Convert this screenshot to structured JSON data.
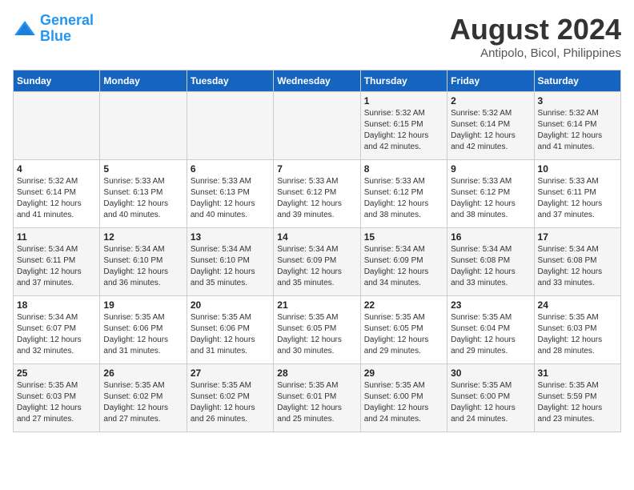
{
  "header": {
    "logo_line1": "General",
    "logo_line2": "Blue",
    "main_title": "August 2024",
    "subtitle": "Antipolo, Bicol, Philippines"
  },
  "weekdays": [
    "Sunday",
    "Monday",
    "Tuesday",
    "Wednesday",
    "Thursday",
    "Friday",
    "Saturday"
  ],
  "weeks": [
    [
      {
        "day": "",
        "info": ""
      },
      {
        "day": "",
        "info": ""
      },
      {
        "day": "",
        "info": ""
      },
      {
        "day": "",
        "info": ""
      },
      {
        "day": "1",
        "info": "Sunrise: 5:32 AM\nSunset: 6:15 PM\nDaylight: 12 hours and 42 minutes."
      },
      {
        "day": "2",
        "info": "Sunrise: 5:32 AM\nSunset: 6:14 PM\nDaylight: 12 hours and 42 minutes."
      },
      {
        "day": "3",
        "info": "Sunrise: 5:32 AM\nSunset: 6:14 PM\nDaylight: 12 hours and 41 minutes."
      }
    ],
    [
      {
        "day": "4",
        "info": "Sunrise: 5:32 AM\nSunset: 6:14 PM\nDaylight: 12 hours and 41 minutes."
      },
      {
        "day": "5",
        "info": "Sunrise: 5:33 AM\nSunset: 6:13 PM\nDaylight: 12 hours and 40 minutes."
      },
      {
        "day": "6",
        "info": "Sunrise: 5:33 AM\nSunset: 6:13 PM\nDaylight: 12 hours and 40 minutes."
      },
      {
        "day": "7",
        "info": "Sunrise: 5:33 AM\nSunset: 6:12 PM\nDaylight: 12 hours and 39 minutes."
      },
      {
        "day": "8",
        "info": "Sunrise: 5:33 AM\nSunset: 6:12 PM\nDaylight: 12 hours and 38 minutes."
      },
      {
        "day": "9",
        "info": "Sunrise: 5:33 AM\nSunset: 6:12 PM\nDaylight: 12 hours and 38 minutes."
      },
      {
        "day": "10",
        "info": "Sunrise: 5:33 AM\nSunset: 6:11 PM\nDaylight: 12 hours and 37 minutes."
      }
    ],
    [
      {
        "day": "11",
        "info": "Sunrise: 5:34 AM\nSunset: 6:11 PM\nDaylight: 12 hours and 37 minutes."
      },
      {
        "day": "12",
        "info": "Sunrise: 5:34 AM\nSunset: 6:10 PM\nDaylight: 12 hours and 36 minutes."
      },
      {
        "day": "13",
        "info": "Sunrise: 5:34 AM\nSunset: 6:10 PM\nDaylight: 12 hours and 35 minutes."
      },
      {
        "day": "14",
        "info": "Sunrise: 5:34 AM\nSunset: 6:09 PM\nDaylight: 12 hours and 35 minutes."
      },
      {
        "day": "15",
        "info": "Sunrise: 5:34 AM\nSunset: 6:09 PM\nDaylight: 12 hours and 34 minutes."
      },
      {
        "day": "16",
        "info": "Sunrise: 5:34 AM\nSunset: 6:08 PM\nDaylight: 12 hours and 33 minutes."
      },
      {
        "day": "17",
        "info": "Sunrise: 5:34 AM\nSunset: 6:08 PM\nDaylight: 12 hours and 33 minutes."
      }
    ],
    [
      {
        "day": "18",
        "info": "Sunrise: 5:34 AM\nSunset: 6:07 PM\nDaylight: 12 hours and 32 minutes."
      },
      {
        "day": "19",
        "info": "Sunrise: 5:35 AM\nSunset: 6:06 PM\nDaylight: 12 hours and 31 minutes."
      },
      {
        "day": "20",
        "info": "Sunrise: 5:35 AM\nSunset: 6:06 PM\nDaylight: 12 hours and 31 minutes."
      },
      {
        "day": "21",
        "info": "Sunrise: 5:35 AM\nSunset: 6:05 PM\nDaylight: 12 hours and 30 minutes."
      },
      {
        "day": "22",
        "info": "Sunrise: 5:35 AM\nSunset: 6:05 PM\nDaylight: 12 hours and 29 minutes."
      },
      {
        "day": "23",
        "info": "Sunrise: 5:35 AM\nSunset: 6:04 PM\nDaylight: 12 hours and 29 minutes."
      },
      {
        "day": "24",
        "info": "Sunrise: 5:35 AM\nSunset: 6:03 PM\nDaylight: 12 hours and 28 minutes."
      }
    ],
    [
      {
        "day": "25",
        "info": "Sunrise: 5:35 AM\nSunset: 6:03 PM\nDaylight: 12 hours and 27 minutes."
      },
      {
        "day": "26",
        "info": "Sunrise: 5:35 AM\nSunset: 6:02 PM\nDaylight: 12 hours and 27 minutes."
      },
      {
        "day": "27",
        "info": "Sunrise: 5:35 AM\nSunset: 6:02 PM\nDaylight: 12 hours and 26 minutes."
      },
      {
        "day": "28",
        "info": "Sunrise: 5:35 AM\nSunset: 6:01 PM\nDaylight: 12 hours and 25 minutes."
      },
      {
        "day": "29",
        "info": "Sunrise: 5:35 AM\nSunset: 6:00 PM\nDaylight: 12 hours and 24 minutes."
      },
      {
        "day": "30",
        "info": "Sunrise: 5:35 AM\nSunset: 6:00 PM\nDaylight: 12 hours and 24 minutes."
      },
      {
        "day": "31",
        "info": "Sunrise: 5:35 AM\nSunset: 5:59 PM\nDaylight: 12 hours and 23 minutes."
      }
    ]
  ]
}
